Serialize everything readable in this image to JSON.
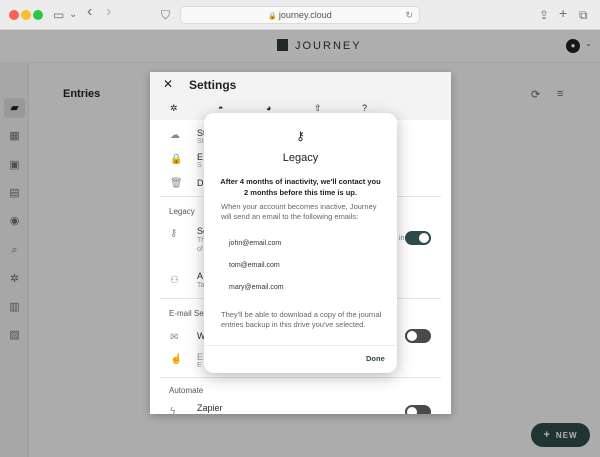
{
  "browser": {
    "url": "journey.cloud",
    "lock_glyph": "🔒",
    "reload_glyph": "↻",
    "icons": {
      "sidebar": "▭",
      "caret": "⌄",
      "back": "‹",
      "forward": "›",
      "shield": "⛉",
      "share": "⇪",
      "new_tab": "+",
      "tabs": "⧉"
    }
  },
  "app": {
    "brand": "JOURNEY",
    "avatar_glyph": "●",
    "avatar_caret": "⌄",
    "entries_title": "Entries",
    "sync_glyph": "⟳",
    "filter_glyph": "≡",
    "new_button_plus": "+",
    "new_button_label": "NEW",
    "sidebar_icons": [
      {
        "name": "briefcase-icon",
        "glyph": "▰"
      },
      {
        "name": "calendar-icon",
        "glyph": "▦"
      },
      {
        "name": "photo-icon",
        "glyph": "▣"
      },
      {
        "name": "map-icon",
        "glyph": "▤"
      },
      {
        "name": "gps-icon",
        "glyph": "◉"
      },
      {
        "name": "search-icon",
        "glyph": "⌕"
      },
      {
        "name": "gear-icon",
        "glyph": "✲"
      },
      {
        "name": "toolbox-icon",
        "glyph": "▥"
      },
      {
        "name": "gift-icon",
        "glyph": "▨"
      }
    ]
  },
  "settings": {
    "close_glyph": "✕",
    "title": "Settings",
    "tabs": [
      {
        "name": "tab-general",
        "glyph": "✲"
      },
      {
        "name": "tab-account",
        "glyph": "◓"
      },
      {
        "name": "tab-theme",
        "glyph": "◕"
      },
      {
        "name": "tab-export",
        "glyph": "⇧"
      },
      {
        "name": "tab-help",
        "glyph": "?"
      }
    ],
    "rows": {
      "storage": {
        "glyph": "☁",
        "text": "St",
        "sub": "St"
      },
      "encryption": {
        "glyph": "🔒",
        "text": "E",
        "sub": "S"
      },
      "delete": {
        "glyph": "🗑",
        "text": "D"
      },
      "legacy_section": "Legacy",
      "legacy": {
        "glyph": "⚷",
        "text": "Se",
        "sub1": "Th",
        "sub2": "of",
        "toggle_label": "in"
      },
      "add_contact": {
        "glyph": "⚇",
        "text": "A",
        "sub": "Ta"
      },
      "email_section": "E-mail Se",
      "weekly": {
        "glyph": "✉",
        "text": "W"
      },
      "email_two": {
        "glyph": "☝",
        "text": "E",
        "sub": "E"
      },
      "automate_section": "Automate",
      "zapier": {
        "glyph": "ϟ",
        "text": "Zapier"
      }
    }
  },
  "legacy_modal": {
    "icon": "⚷",
    "title": "Legacy",
    "lead": "After 4 months of inactivity, we'll contact you 2 months before this time is up.",
    "body": "When your account becomes inactive, Journey will send an email to the following emails:",
    "emails": [
      "john@email.com",
      "tom@email.com",
      "mary@email.com"
    ],
    "footer": "They'll be able to download a copy of the journal entries backup in this drive you've selected.",
    "done_label": "Done"
  }
}
